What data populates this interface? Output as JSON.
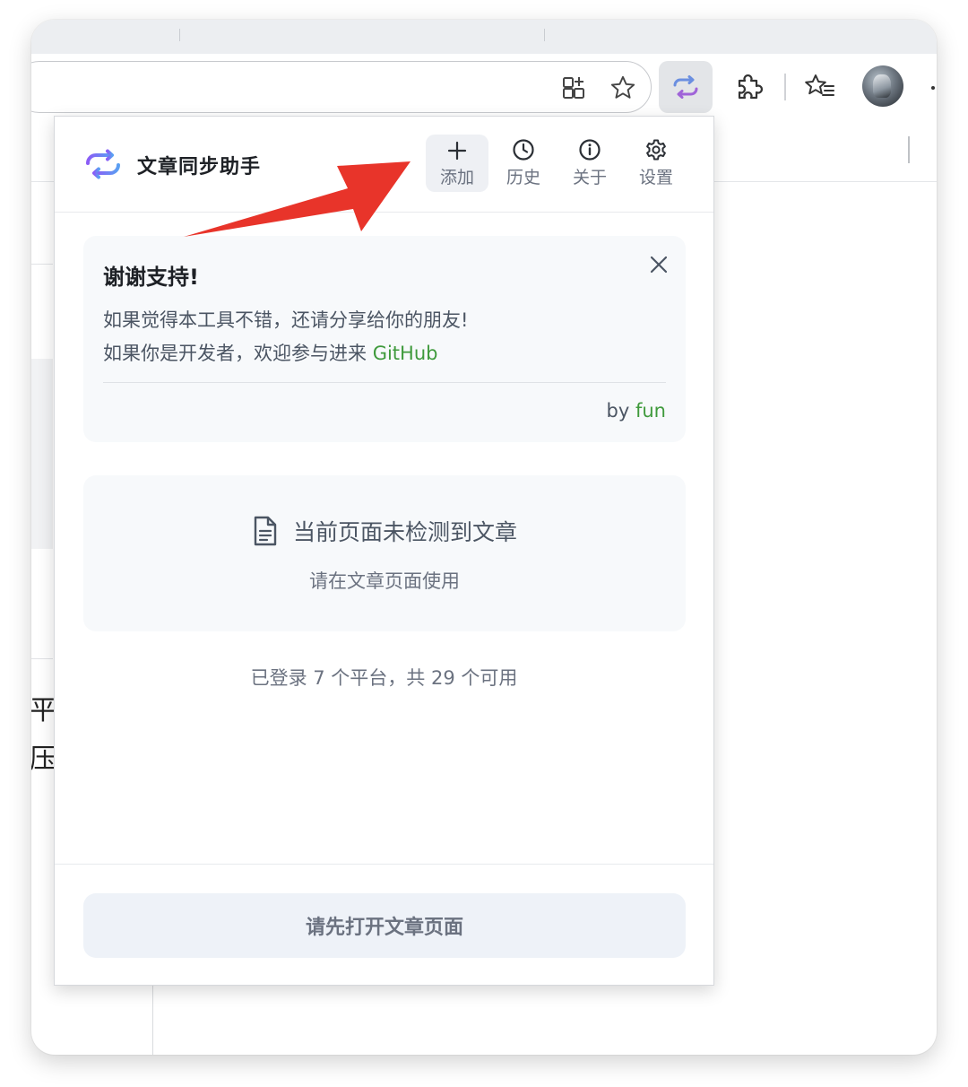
{
  "popup": {
    "app_title": "文章同步助手",
    "header_buttons": [
      {
        "label": "添加",
        "icon": "plus-icon"
      },
      {
        "label": "历史",
        "icon": "clock-icon"
      },
      {
        "label": "关于",
        "icon": "info-icon"
      },
      {
        "label": "设置",
        "icon": "gear-icon"
      }
    ],
    "notice": {
      "title": "谢谢支持!",
      "line1": "如果觉得本工具不错，还请分享给你的朋友!",
      "line2_prefix": "如果你是开发者，欢迎参与进来 ",
      "line2_link": "GitHub",
      "by_prefix": "by ",
      "by_name": "fun",
      "close_icon": "close-icon"
    },
    "empty_state": {
      "icon": "document-icon",
      "title": "当前页面未检测到文章",
      "subtitle": "请在文章页面使用"
    },
    "status": "已登录 7 个平台，共 29 个可用",
    "primary_button": "请先打开文章页面"
  },
  "background_page": {
    "fragment_1": "平台",
    "fragment_2": "压"
  },
  "colors": {
    "link_green": "#3f9a3c",
    "annotation_red": "#e8342a",
    "button_bg": "#eef2f8"
  }
}
